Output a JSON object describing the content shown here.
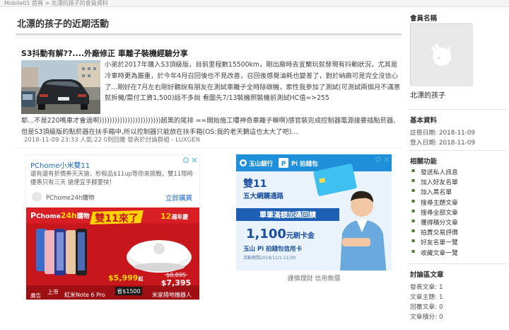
{
  "breadcrumb": "Mobile01 首頁 > 北漂的孩子的會員資料",
  "page_title": "北漂的孩子的近期活動",
  "post": {
    "title": "S3抖動有解??....外廠修正 車離子裝機經驗分享",
    "body_line1": "小弟於2017年購入S3頂級版，目前里程數15500km，剛出廠時去宜蘭玩就發現有抖動狀況，尤其是冷車時更為嚴重，於今年4月召回後也不見改善，召回後感覺油耗也變差了，對於納廠可是完全沒信心了...剛好在7月左右剛好聽說有朋友在測試車離子全時除碳機，索性我參加了測試(可測試兩個月不滿意就拆機/需付工資1,500)話不多說 看圖先7/13裝機照裝機前測試HC值=>255",
    "body_line2": "耶...不是220嗎車才會過啊))))))))))))))))))))))))超黑的尾排 ==開始施工嘍神奇車離子嘛啊)感官裝完成控制器電源接要插點菸器,但是S3頂級版的點菸器在扶手箱中,所以控制器只能放在扶手箱(OS:我的老天鵝這也太大了吧)...",
    "meta": "2018-11-09 23:33  人氣:22  0則回覆  發表於討論群組 - LUXGEN"
  },
  "ad_left": {
    "title": "PChome小米雙11",
    "description": "還有還有折價券天天搶、秒殺品$11up等你來挑戰，雙11限時優惠只有三天 搶便宜手腳要快！",
    "brand": "PChome24h購物",
    "cta": "立即購買",
    "banner_logo_p": "P",
    "banner_logo_rest": "Chome",
    "banner_logo_24": "24h",
    "banner_logo_suffix": "購物",
    "banner_slogan": "雙11來了",
    "banner_anniv": "12",
    "banner_anniv_suffix": "週年慶",
    "price_phone": "$5,999",
    "price_phone_unit": "起",
    "price_vac_old": "$8,895",
    "price_vac": "$7,395",
    "save_label": "省$1500",
    "phone_label": "紅米Note 6 Pro",
    "vac_label": "米家掃地機器人",
    "launch_label": "上市",
    "ad_badge": "廣告"
  },
  "ad_right": {
    "bank": "玉山銀行",
    "pay": "Pi 拍錢包",
    "headline": "雙11",
    "sub": "五大網購通路",
    "band1": "單筆滿額加碼回饋",
    "amount": "1,100",
    "amount_suffix": "元刷卡金",
    "card_name": "玉山 Pi 拍錢包信用卡",
    "note": "活動期間2018/11/1-11/30",
    "footer": "謹慎理財 信用無價"
  },
  "sidebar": {
    "member_heading": "會員名稱",
    "member_name": "北漂的孩子",
    "basic_heading": "基本資料",
    "register_date": "註冊日期: 2018-11-09",
    "login_date": "登入日期: 2018-11-09",
    "func_heading": "相關功能",
    "functions": [
      "發送私人訊息",
      "加入好友名單",
      "加入黑名單",
      "搜尋主題文章",
      "搜尋全部文章",
      "獲得積分文章",
      "拍賣交易評價",
      "好友名單一覽",
      "收藏文章一覽"
    ],
    "forum_heading": "討論區文章",
    "forum_stats": [
      "發表文章: 1",
      "文章主題: 1",
      "回覆文章: 0",
      "文章積分: 0"
    ]
  }
}
